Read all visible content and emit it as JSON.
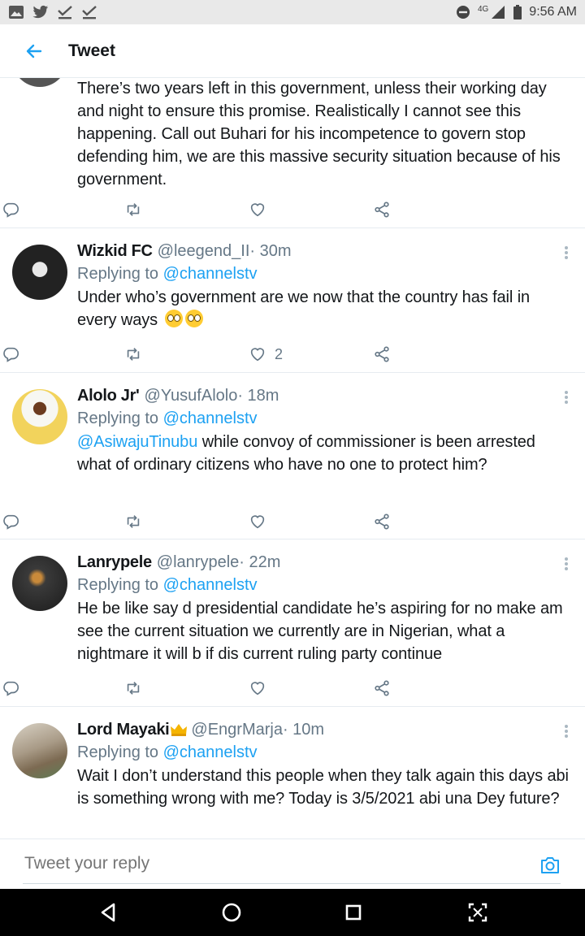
{
  "status_bar": {
    "time": "9:56 AM",
    "network": "4G",
    "left_icons": [
      "gallery-icon",
      "twitter-icon",
      "download-done-icon",
      "download-done-icon"
    ],
    "right_icons": [
      "do-not-disturb-icon",
      "signal-icon",
      "battery-icon"
    ]
  },
  "header": {
    "title": "Tweet"
  },
  "tweets": [
    {
      "body": "There’s two years left in this government, unless their working day and night to ensure this promise. Realistically I cannot see this happening. Call out Buhari for his incompetence to govern stop defending him, we are this massive security situation because of his government.",
      "likes": ""
    },
    {
      "name": "Wizkid FC",
      "handle": "@leegend_II",
      "time": " · 30m",
      "replying_prefix": "Replying to ",
      "replying_to": "@channelstv",
      "body": "Under who’s government are we now that the country has fail in every ways",
      "emoji": [
        "rolling-eyes-emoji",
        "rolling-eyes-emoji"
      ],
      "likes": "2"
    },
    {
      "name": "Alolo Jr'",
      "handle": "@YusufAlolo",
      "time": " · 18m",
      "replying_prefix": "Replying to ",
      "replying_to": "@channelstv",
      "mention": "@AsiwajuTinubu",
      "body": " while convoy of commissioner is been arrested what of ordinary citizens who have no one to protect him?",
      "likes": ""
    },
    {
      "name": "Lanrypele",
      "handle": "@lanrypele",
      "time": " · 22m",
      "replying_prefix": "Replying to ",
      "replying_to": "@channelstv",
      "body": "He be like say d presidential candidate he’s aspiring for no make am see the current situation we currently are in Nigerian, what a nightmare it will b if dis current ruling party continue",
      "likes": ""
    },
    {
      "name": "Lord Mayaki",
      "handle": "@EngrMarja",
      "time": " · 10m",
      "replying_prefix": "Replying to ",
      "replying_to": "@channelstv",
      "body": "Wait I don’t understand this people when they talk again this days abi is something wrong with me? Today is 3/5/2021 abi una Dey future?",
      "likes": ""
    }
  ],
  "reply_bar": {
    "placeholder": "Tweet your reply"
  },
  "colors": {
    "accent": "#1da1f2",
    "secondary_text": "#657786",
    "divider": "#e6ecf0"
  }
}
